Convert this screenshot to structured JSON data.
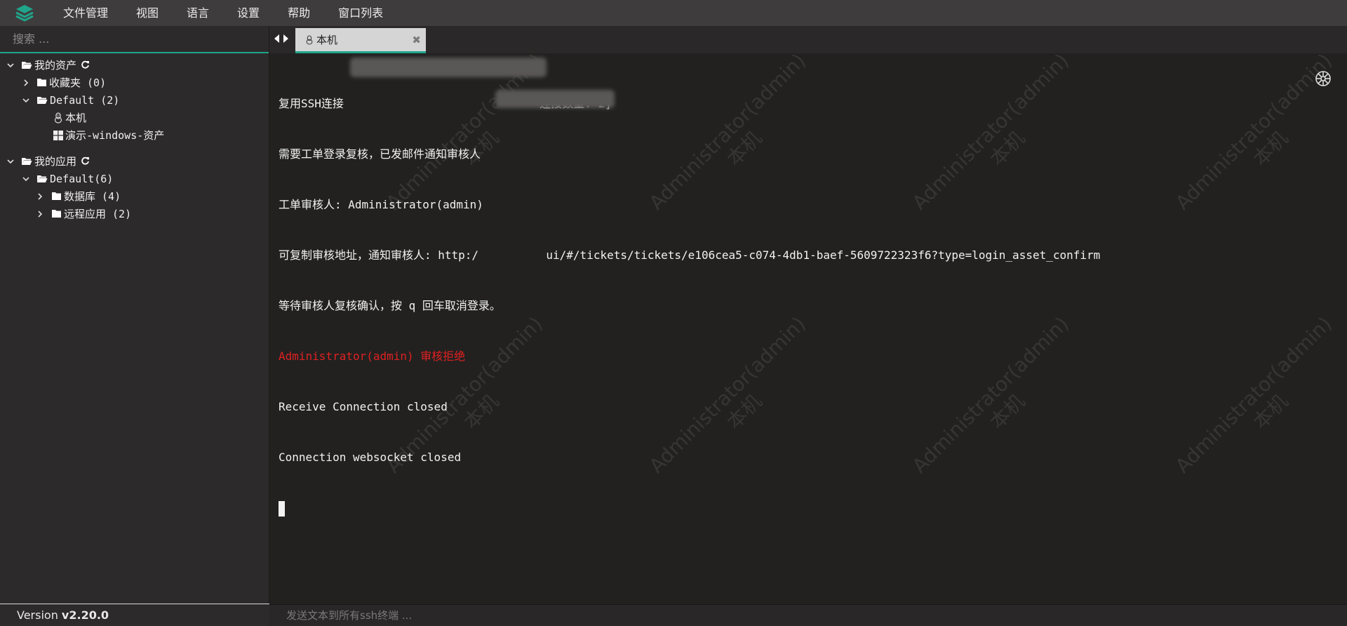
{
  "app": {
    "accent_color": "#1fa58a",
    "logo_icon": "stacked-layers-logo"
  },
  "menubar": {
    "items": [
      "文件管理",
      "视图",
      "语言",
      "设置",
      "帮助",
      "窗口列表"
    ]
  },
  "sidebar": {
    "search_placeholder": "搜索 ...",
    "assets": {
      "label": "我的资产",
      "favorites": "收藏夹 (0)",
      "default_group": "Default (2)",
      "hosts": [
        {
          "label": "本机",
          "icon": "linux-icon"
        },
        {
          "label": "演示-windows-资产",
          "icon": "windows-icon"
        }
      ]
    },
    "apps": {
      "label": "我的应用",
      "default_group": "Default(6)",
      "children": [
        "数据库 (4)",
        "远程应用 (2)"
      ]
    },
    "version_prefix": "Version ",
    "version": "v2.20.0"
  },
  "tabs": [
    {
      "label": "本机",
      "icon": "linux-icon",
      "active": true
    }
  ],
  "terminal": {
    "lines": [
      {
        "text": "复用SSH连接                             连接数量: 2]",
        "color": "#f2f2f2"
      },
      {
        "text": "需要工单登录复核，已发邮件通知审核人",
        "color": "#f2f2f2"
      },
      {
        "text": "工单审核人: Administrator(admin)",
        "color": "#f2f2f2"
      },
      {
        "text": "可复制审核地址，通知审核人: http:/          ui/#/tickets/tickets/e106cea5-c074-4db1-baef-5609722323f6?type=login_asset_confirm",
        "color": "#f2f2f2"
      },
      {
        "text": "等待审核人复核确认，按 q 回车取消登录。",
        "color": "#f2f2f2"
      },
      {
        "text": "Administrator(admin) 审核拒绝",
        "color": "#e02020"
      },
      {
        "text": "Receive Connection closed",
        "color": "#f2f2f2"
      },
      {
        "text": "Connection websocket closed",
        "color": "#f2f2f2"
      }
    ],
    "watermark_user": "Administrator(admin)",
    "watermark_host": "本机"
  },
  "broadcast": {
    "placeholder": "发送文本到所有ssh终端 ..."
  }
}
